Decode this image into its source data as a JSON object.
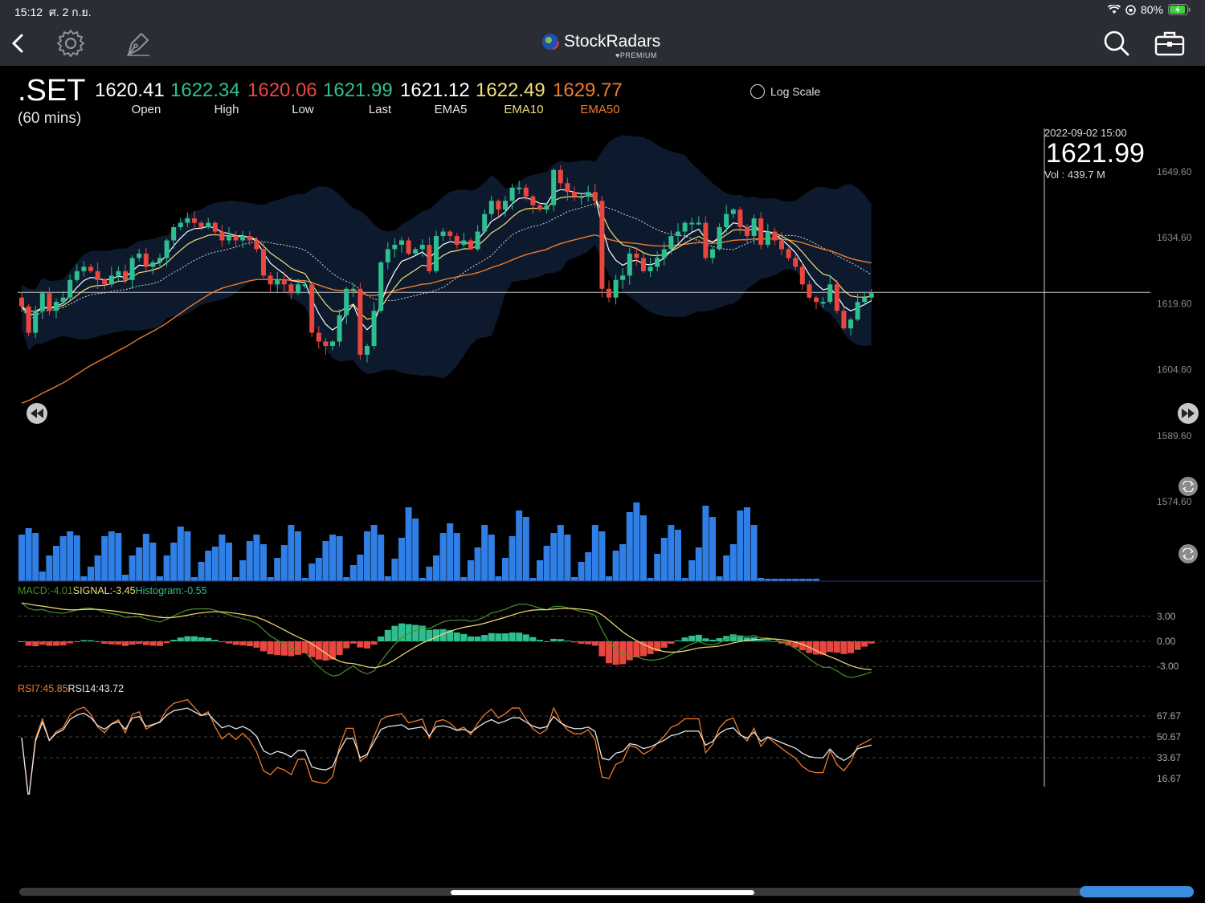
{
  "status_bar": {
    "time": "15:12",
    "date": "ศ. 2 ก.ย.",
    "battery": "80%"
  },
  "app": {
    "name": "StockRadars",
    "badge": "PREMIUM"
  },
  "icons": {
    "back": "chevron-left-icon",
    "settings": "gear-icon",
    "draw": "pen-nib-icon",
    "search": "search-icon",
    "portfolio": "briefcase-icon"
  },
  "quote": {
    "symbol": ".SET",
    "interval": "(60 mins)",
    "fields": [
      {
        "value": "1620.41",
        "label": "Open",
        "color": "#ffffff",
        "label_color": "#e6e6e6"
      },
      {
        "value": "1622.34",
        "label": "High",
        "color": "#2fbf8f",
        "label_color": "#e6e6e6"
      },
      {
        "value": "1620.06",
        "label": "Low",
        "color": "#e8473f",
        "label_color": "#e6e6e6"
      },
      {
        "value": "1621.99",
        "label": "Last",
        "color": "#2fbf8f",
        "label_color": "#e6e6e6"
      },
      {
        "value": "1621.12",
        "label": "EMA5",
        "color": "#ffffff",
        "label_color": "#e6e6e6"
      },
      {
        "value": "1622.49",
        "label": "EMA10",
        "color": "#f3df7a",
        "label_color": "#f3df7a"
      },
      {
        "value": "1629.77",
        "label": "EMA50",
        "color": "#f07a2a",
        "label_color": "#f07a2a"
      }
    ]
  },
  "log_scale_label": "Log Scale",
  "cursor": {
    "datetime": "2022-09-02 15:00",
    "price": "1621.99",
    "volume": "Vol    : 439.7 M"
  },
  "price_axis": [
    "1649.60",
    "1634.60",
    "1619.60",
    "1604.60",
    "1589.60",
    "1574.60"
  ],
  "macd": {
    "label_macd": "MACD:-4.01",
    "label_signal": "SIGNAL:-3.45",
    "label_hist": "Histogram:-0.55",
    "ticks": [
      "3.00",
      "0.00",
      "-3.00"
    ]
  },
  "rsi": {
    "label_rsi7": "RSI7:45.85",
    "label_rsi14": "RSI14:43.72",
    "ticks": [
      "67.67",
      "50.67",
      "33.67",
      "16.67"
    ]
  },
  "colors": {
    "up": "#2fbf8f",
    "down": "#e8473f",
    "ema5": "#ffffff",
    "ema10": "#f3df7a",
    "ema50": "#f07a2a",
    "band": "#0d1a2e",
    "volume": "#2f7fe6"
  },
  "chart_data": {
    "type": "candlestick",
    "title": ".SET (60 mins)",
    "ylim": [
      1574.6,
      1649.6
    ],
    "closes": [
      1619,
      1613,
      1618,
      1622,
      1618,
      1620,
      1621,
      1625,
      1627,
      1628,
      1627,
      1625,
      1624,
      1626,
      1627,
      1625,
      1630,
      1631,
      1628,
      1629,
      1630,
      1634,
      1637,
      1638,
      1639,
      1638,
      1637,
      1638,
      1636,
      1634,
      1635,
      1634,
      1635,
      1634,
      1632,
      1626,
      1624,
      1625,
      1624,
      1622,
      1624,
      1624,
      1613,
      1611,
      1610,
      1611,
      1617,
      1623,
      1623,
      1608,
      1610,
      1618,
      1629,
      1632,
      1633,
      1634,
      1631,
      1632,
      1633,
      1627,
      1635,
      1636,
      1635,
      1633,
      1634,
      1632,
      1636,
      1640,
      1643,
      1641,
      1643,
      1646,
      1646,
      1644,
      1642,
      1641,
      1642,
      1650,
      1647,
      1645,
      1644,
      1644,
      1645,
      1643,
      1623,
      1621,
      1625,
      1626,
      1631,
      1630,
      1627,
      1628,
      1630,
      1632,
      1635,
      1636,
      1638,
      1638,
      1638,
      1630,
      1632,
      1637,
      1640,
      1641,
      1637,
      1635,
      1639,
      1633,
      1636,
      1634,
      1632,
      1630,
      1628,
      1624,
      1621,
      1620,
      1620,
      1624,
      1618,
      1614,
      1616,
      1620,
      1621,
      1622
    ],
    "volume": [
      58,
      66,
      60,
      12,
      32,
      44,
      56,
      62,
      57,
      6,
      18,
      32,
      56,
      62,
      60,
      8,
      32,
      42,
      59,
      48,
      6,
      32,
      48,
      68,
      62,
      5,
      24,
      38,
      43,
      58,
      48,
      5,
      26,
      50,
      58,
      46,
      5,
      29,
      45,
      70,
      62,
      4,
      22,
      29,
      50,
      58,
      56,
      5,
      20,
      33,
      62,
      70,
      58,
      6,
      28,
      54,
      92,
      78,
      4,
      18,
      32,
      60,
      72,
      60,
      5,
      26,
      42,
      70,
      58,
      6,
      29,
      56,
      88,
      80,
      4,
      26,
      44,
      60,
      70,
      58,
      5,
      24,
      36,
      70,
      62,
      6,
      38,
      46,
      86,
      98,
      82,
      4,
      34,
      54,
      70,
      64,
      4,
      26,
      42,
      94,
      80,
      6,
      32,
      46,
      88,
      92,
      70,
      4,
      3,
      3,
      3,
      3,
      3,
      3,
      3,
      3
    ],
    "macd": [
      -4.01
    ],
    "signal": [
      -3.45
    ],
    "histogram": [
      -0.55
    ],
    "rsi7": [
      45.85
    ],
    "rsi14": [
      43.72
    ]
  }
}
